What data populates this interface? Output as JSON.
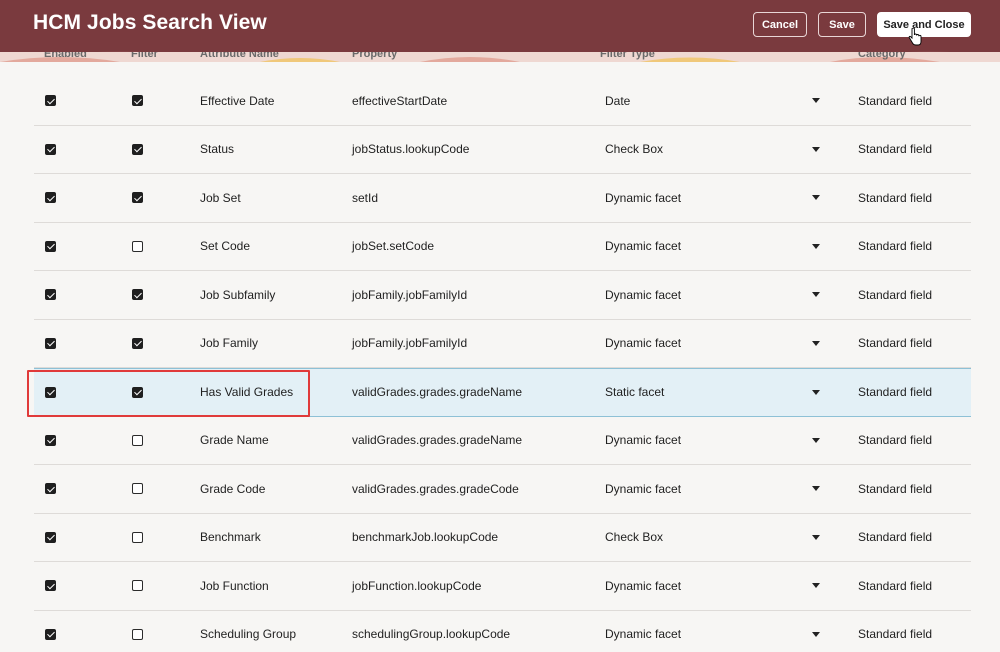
{
  "header": {
    "title": "HCM Jobs Search View",
    "cancel_label": "Cancel",
    "save_label": "Save",
    "save_close_label": "Save and Close"
  },
  "columns": [
    "Enabled",
    "Filter",
    "Attribute Name",
    "Property",
    "Filter Type",
    "Category"
  ],
  "rows": [
    {
      "enabled": true,
      "filter": true,
      "name": "Effective Date",
      "property": "effectiveStartDate",
      "filter_type": "Date",
      "category": "Standard field"
    },
    {
      "enabled": true,
      "filter": true,
      "name": "Status",
      "property": "jobStatus.lookupCode",
      "filter_type": "Check Box",
      "category": "Standard field"
    },
    {
      "enabled": true,
      "filter": true,
      "name": "Job Set",
      "property": "setId",
      "filter_type": "Dynamic facet",
      "category": "Standard field"
    },
    {
      "enabled": true,
      "filter": false,
      "name": "Set Code",
      "property": "jobSet.setCode",
      "filter_type": "Dynamic facet",
      "category": "Standard field"
    },
    {
      "enabled": true,
      "filter": true,
      "name": "Job Subfamily",
      "property": "jobFamily.jobFamilyId",
      "filter_type": "Dynamic facet",
      "category": "Standard field"
    },
    {
      "enabled": true,
      "filter": true,
      "name": "Job Family",
      "property": "jobFamily.jobFamilyId",
      "filter_type": "Dynamic facet",
      "category": "Standard field"
    },
    {
      "enabled": true,
      "filter": true,
      "name": "Has Valid Grades",
      "property": "validGrades.grades.gradeName",
      "filter_type": "Static facet",
      "category": "Standard field",
      "selected": true
    },
    {
      "enabled": true,
      "filter": false,
      "name": "Grade Name",
      "property": "validGrades.grades.gradeName",
      "filter_type": "Dynamic facet",
      "category": "Standard field"
    },
    {
      "enabled": true,
      "filter": false,
      "name": "Grade Code",
      "property": "validGrades.grades.gradeCode",
      "filter_type": "Dynamic facet",
      "category": "Standard field"
    },
    {
      "enabled": true,
      "filter": false,
      "name": "Benchmark",
      "property": "benchmarkJob.lookupCode",
      "filter_type": "Check Box",
      "category": "Standard field"
    },
    {
      "enabled": true,
      "filter": false,
      "name": "Job Function",
      "property": "jobFunction.lookupCode",
      "filter_type": "Dynamic facet",
      "category": "Standard field"
    },
    {
      "enabled": true,
      "filter": false,
      "name": "Scheduling Group",
      "property": "schedulingGroup.lookupCode",
      "filter_type": "Dynamic facet",
      "category": "Standard field"
    }
  ],
  "colors": {
    "header_bg": "#7a3a3e",
    "selected_row": "#e3f0f6",
    "annotation": "#e03a3a"
  }
}
